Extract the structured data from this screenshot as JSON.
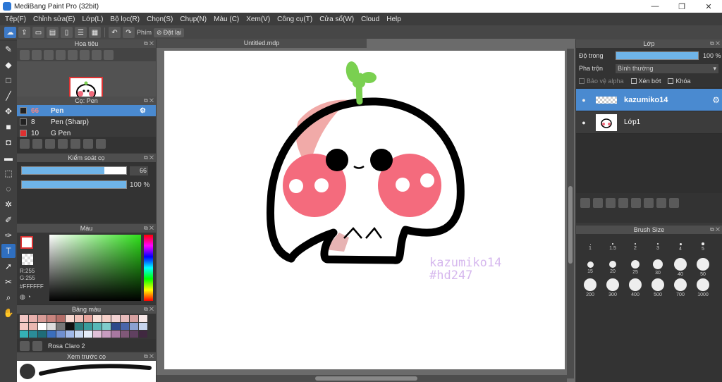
{
  "window": {
    "title": "MediBang Paint Pro (32bit)",
    "minimize": "—",
    "maximize": "❐",
    "close": "✕"
  },
  "menu": [
    "Tệp(F)",
    "Chỉnh sửa(E)",
    "Lớp(L)",
    "Bộ lọc(R)",
    "Chọn(S)",
    "Chụp(N)",
    "Màu (C)",
    "Xem(V)",
    "Công cụ(T)",
    "Cửa sổ(W)",
    "Cloud",
    "Help"
  ],
  "toolbar": {
    "shortcut_label": "Phím",
    "reset_label": "Đặt lại"
  },
  "navigator": {
    "title": "Hoa tiêu"
  },
  "brush_panel": {
    "title": "Cọ: Pen",
    "items": [
      {
        "size": "66",
        "name": "Pen",
        "color": "#222222"
      },
      {
        "size": "8",
        "name": "Pen (Sharp)",
        "color": "#222222"
      },
      {
        "size": "10",
        "name": "G Pen",
        "color": "#e03030"
      }
    ]
  },
  "brush_control": {
    "title": "Kiểm soát cọ",
    "size_value": "66",
    "size_fraction": 0.79,
    "opacity_value": "100 %",
    "opacity_fraction": 1.0
  },
  "color_panel": {
    "title": "Màu",
    "r_label": "R:255",
    "g_label": "G:255",
    "hex": "#FFFFFF",
    "foreground": "#ffffff"
  },
  "palette_panel": {
    "title": "Bảng màu",
    "name": "Rosa Claro 2",
    "colors": [
      "#f2c6c4",
      "#e8b0ac",
      "#d99c97",
      "#c9847e",
      "#b36d67",
      "#f7d8d0",
      "#f0c0b8",
      "#e6a49c",
      "#f9e0d8",
      "#f5cfc8",
      "#f2d2d2",
      "#e8bcbc",
      "#d6a0a0",
      "#f8e8e8",
      "#f3c9c4",
      "#e9b7b0",
      "#ffffff",
      "#dddddd",
      "#777777",
      "#111111",
      "#2d7d7d",
      "#3a9c9c",
      "#57b8b8",
      "#7fcccc",
      "#2e4a8a",
      "#4b66aa",
      "#8aa0d0",
      "#c7d4ee",
      "#34b0b5",
      "#2a8c98",
      "#1e6c78",
      "#3a6ebd",
      "#6f8fd0",
      "#a0b8e8",
      "#c8d8f0",
      "#e4ecf8",
      "#e0c0d8",
      "#c89cc0",
      "#a878a0",
      "#805878",
      "#604060",
      "#402840"
    ]
  },
  "preview_panel": {
    "title": "Xem trước cọ"
  },
  "canvas": {
    "tab": "Untitled.mdp",
    "watermark_line1": "kazumiko14",
    "watermark_line2": "#hd247"
  },
  "layer_panel": {
    "title": "Lớp",
    "opacity_label": "Độ trong",
    "opacity_value": "100 %",
    "blend_label": "Pha trộn",
    "blend_value": "Bình thường",
    "alpha_label": "Bảo vệ alpha",
    "clip_label": "Xén bớt",
    "lock_label": "Khóa",
    "layers": [
      {
        "name": "kazumiko14",
        "selected": true
      },
      {
        "name": "Lớp1",
        "selected": false
      }
    ]
  },
  "brush_size_panel": {
    "title": "Brush Size",
    "sizes": [
      "1",
      "1.5",
      "2",
      "3",
      "4",
      "5",
      "15",
      "20",
      "25",
      "30",
      "40",
      "50",
      "200",
      "300",
      "400",
      "500",
      "700",
      "1000"
    ]
  }
}
